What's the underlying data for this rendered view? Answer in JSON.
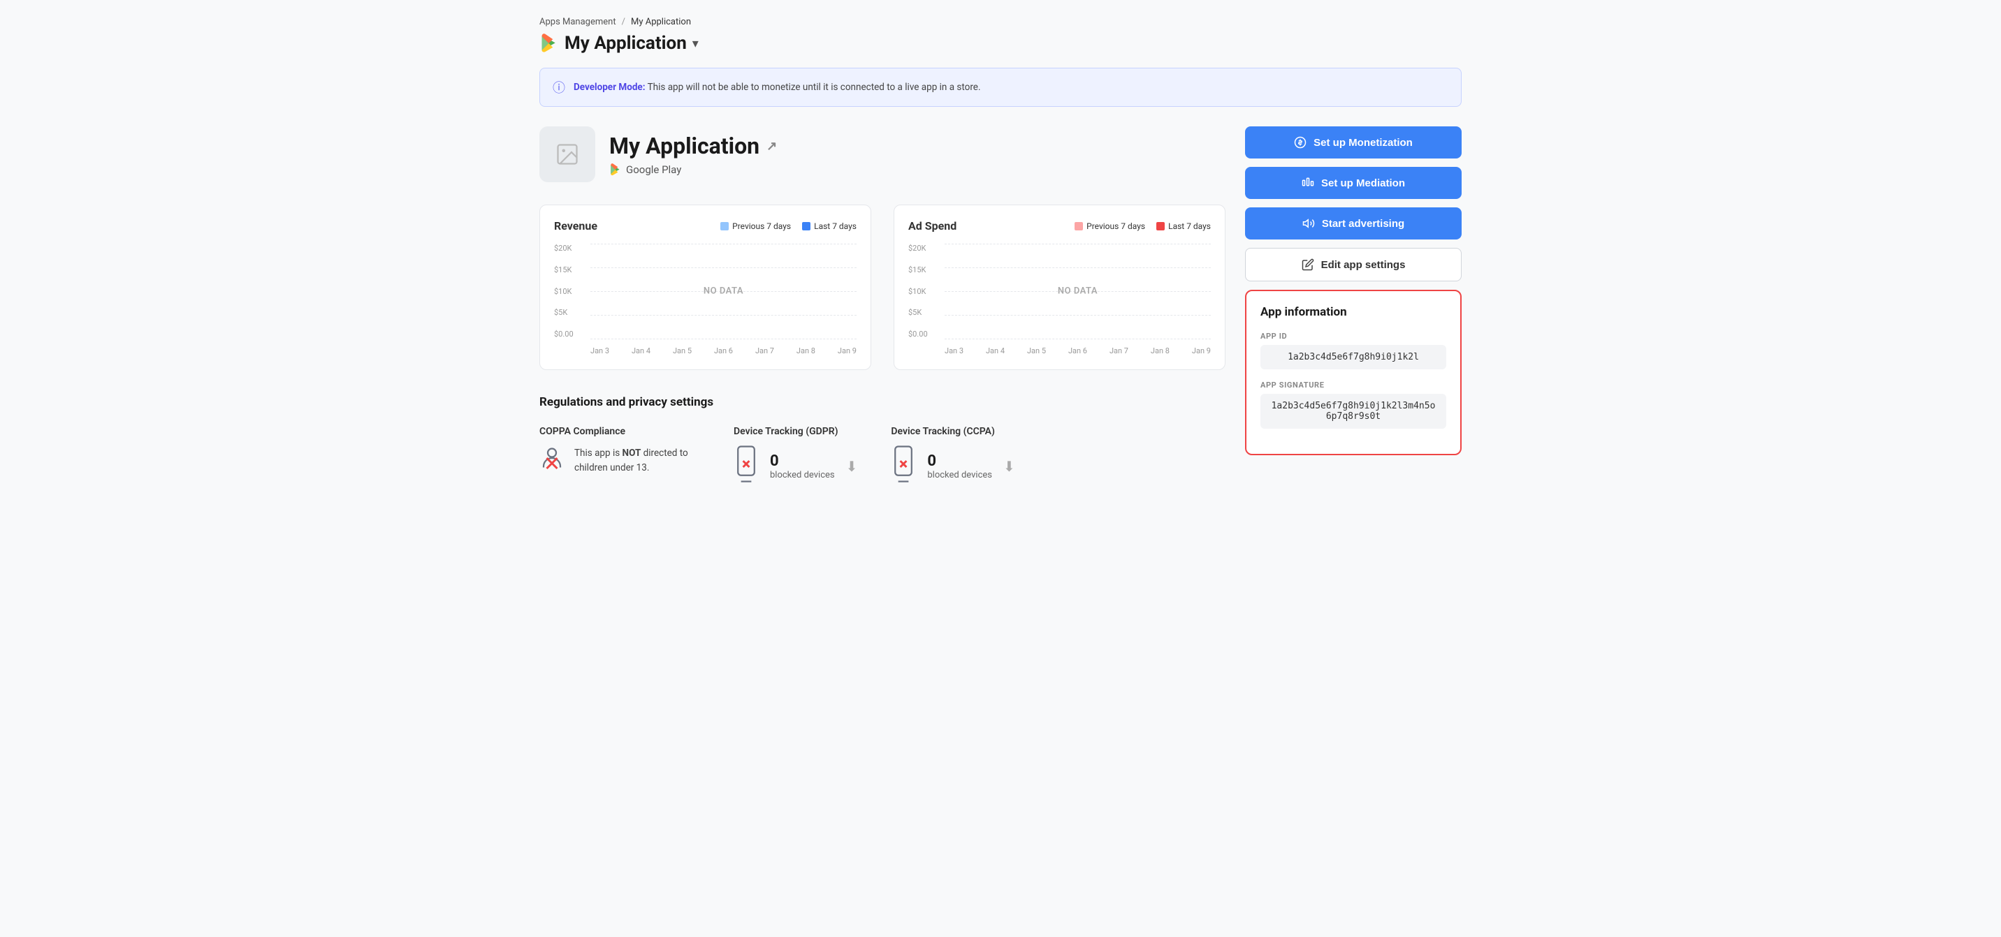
{
  "breadcrumb": {
    "parent": "Apps Management",
    "separator": "/",
    "current": "My Application"
  },
  "appTitle": "My Application",
  "appTitleChevron": "▾",
  "devModeBanner": {
    "label": "Developer Mode:",
    "text": "This app will not be able to monetize until it is connected to a live app in a store."
  },
  "appHeader": {
    "name": "My Application",
    "storeName": "Google Play"
  },
  "revenueChart": {
    "title": "Revenue",
    "legend": {
      "prev": "Previous 7 days",
      "last": "Last 7 days",
      "prevColor": "#93c5fd",
      "lastColor": "#3b82f6"
    },
    "yAxis": [
      "$20K",
      "$15K",
      "$10K",
      "$5K",
      "$0.00"
    ],
    "xAxis": [
      "Jan 3",
      "Jan 4",
      "Jan 5",
      "Jan 6",
      "Jan 7",
      "Jan 8",
      "Jan 9"
    ],
    "noData": "NO DATA"
  },
  "adSpendChart": {
    "title": "Ad Spend",
    "legend": {
      "prev": "Previous 7 days",
      "last": "Last 7 days",
      "prevColor": "#fca5a5",
      "lastColor": "#ef4444"
    },
    "yAxis": [
      "$20K",
      "$15K",
      "$10K",
      "$5K",
      "$0.00"
    ],
    "xAxis": [
      "Jan 3",
      "Jan 4",
      "Jan 5",
      "Jan 6",
      "Jan 7",
      "Jan 8",
      "Jan 9"
    ],
    "noData": "NO DATA"
  },
  "buttons": {
    "monetization": "Set up Monetization",
    "mediation": "Set up Mediation",
    "advertising": "Start advertising",
    "editSettings": "Edit app settings"
  },
  "appInfo": {
    "title": "App information",
    "appIdLabel": "APP ID",
    "appIdValue": "1a2b3c4d5e6f7g8h9i0j1k2l",
    "appSignatureLabel": "APP SIGNATURE",
    "appSignatureValue": "1a2b3c4d5e6f7g8h9i0j1k2l3m4n5o6p7q8r9s0t"
  },
  "regulations": {
    "title": "Regulations and privacy settings",
    "coppa": {
      "label": "COPPA Compliance",
      "text1": "This app is ",
      "bold": "NOT",
      "text2": " directed to children under 13."
    },
    "gdpr": {
      "label": "Device Tracking (GDPR)",
      "count": "0",
      "countLabel": "blocked devices"
    },
    "ccpa": {
      "label": "Device Tracking (CCPA)",
      "count": "0",
      "countLabel": "blocked devices"
    }
  }
}
